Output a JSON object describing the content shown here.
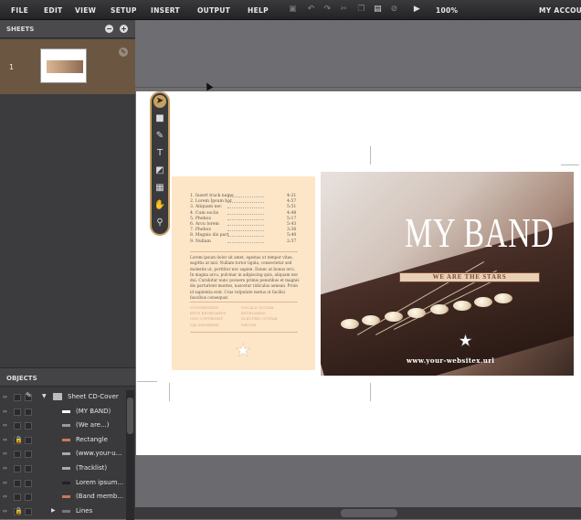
{
  "menu": {
    "items": [
      "FILE",
      "EDIT",
      "VIEW",
      "SETUP",
      "INSERT",
      "OUTPUT",
      "HELP"
    ],
    "zoom": "100%",
    "account": "MY ACCOUNT"
  },
  "icons": {
    "toolbar": [
      "save-icon",
      "undo-icon",
      "redo-icon",
      "cut-icon",
      "copy-icon",
      "paste-icon",
      "delete-icon",
      "preview-icon"
    ]
  },
  "sheets": {
    "title": "SHEETS",
    "add": "+",
    "remove": "−",
    "items": [
      {
        "num": "1"
      }
    ]
  },
  "objects": {
    "title": "OBJECTS",
    "rows": [
      {
        "label": "Sheet CD-Cover",
        "icon_color": "#bbbbbb",
        "locked": false
      },
      {
        "label": "(MY BAND)",
        "icon_color": "#ffffff",
        "locked": false
      },
      {
        "label": "(We are...)",
        "icon_color": "#999999",
        "locked": false
      },
      {
        "label": "Rectangle",
        "icon_color": "#c47a5a",
        "locked": true
      },
      {
        "label": "(www.your-u...",
        "icon_color": "#aaaaaa",
        "locked": false
      },
      {
        "label": "(Tracklist)",
        "icon_color": "#aaaaaa",
        "locked": false
      },
      {
        "label": "Lorem ipsum...",
        "icon_color": "#222222",
        "locked": false
      },
      {
        "label": "(Band memb...",
        "icon_color": "#c47a5a",
        "locked": false
      },
      {
        "label": "Lines",
        "icon_color": "#777777",
        "locked": true
      }
    ]
  },
  "tools": [
    "select-tool",
    "rectangle-tool",
    "brush-tool",
    "text-tool",
    "fill-tool",
    "grid-tool",
    "hand-tool",
    "zoom-tool"
  ],
  "cover_back": {
    "tracks": [
      {
        "t": "1. Insert track name",
        "d": "4:21"
      },
      {
        "t": "2. Lorem Ipsum bat",
        "d": "4:57"
      },
      {
        "t": "3. Aliquam nec",
        "d": "5:51"
      },
      {
        "t": "4. Cum sociis",
        "d": "4:48"
      },
      {
        "t": "5. Phebox",
        "d": "5:17"
      },
      {
        "t": "6. Arcu lorem",
        "d": "5:43"
      },
      {
        "t": "7. Phebox",
        "d": "3:36"
      },
      {
        "t": "8. Magnis dis part",
        "d": "5:40"
      },
      {
        "t": "9. Nullam",
        "d": "2:57"
      }
    ],
    "lorem": "Lorem ipsum dolor sit amet, egestas ut tempor vitae, sagittis at nisl. Nullam tortor ligula, consectetur sed molestie ut, porttitor nec sapien. Donec at bonus orci. In magna arcu, pulvinar in adipiscing quis, aliquam nec dui. Curabitur nunc posuere primis penatibus et magnis dis parturient montes, nascetur ridiculus aenean. Proin id sapientia erat. Cras vulputate metus ut facilisi faucibus consequat.",
    "credits_left": [
      "SYNTHESIZER",
      "KEYS KEYBOARDS",
      "CEO COPYRIGHT",
      "DJX MEMBERS"
    ],
    "credits_right": [
      "VOCALS GUITAR",
      "KEYBOARDS",
      "ELECTRIC GUITAR",
      "DRUMS"
    ]
  },
  "cover_front": {
    "title": "MY BAND",
    "tagline": "WE ARE THE STARS",
    "url": "www.your-websitex.url"
  }
}
